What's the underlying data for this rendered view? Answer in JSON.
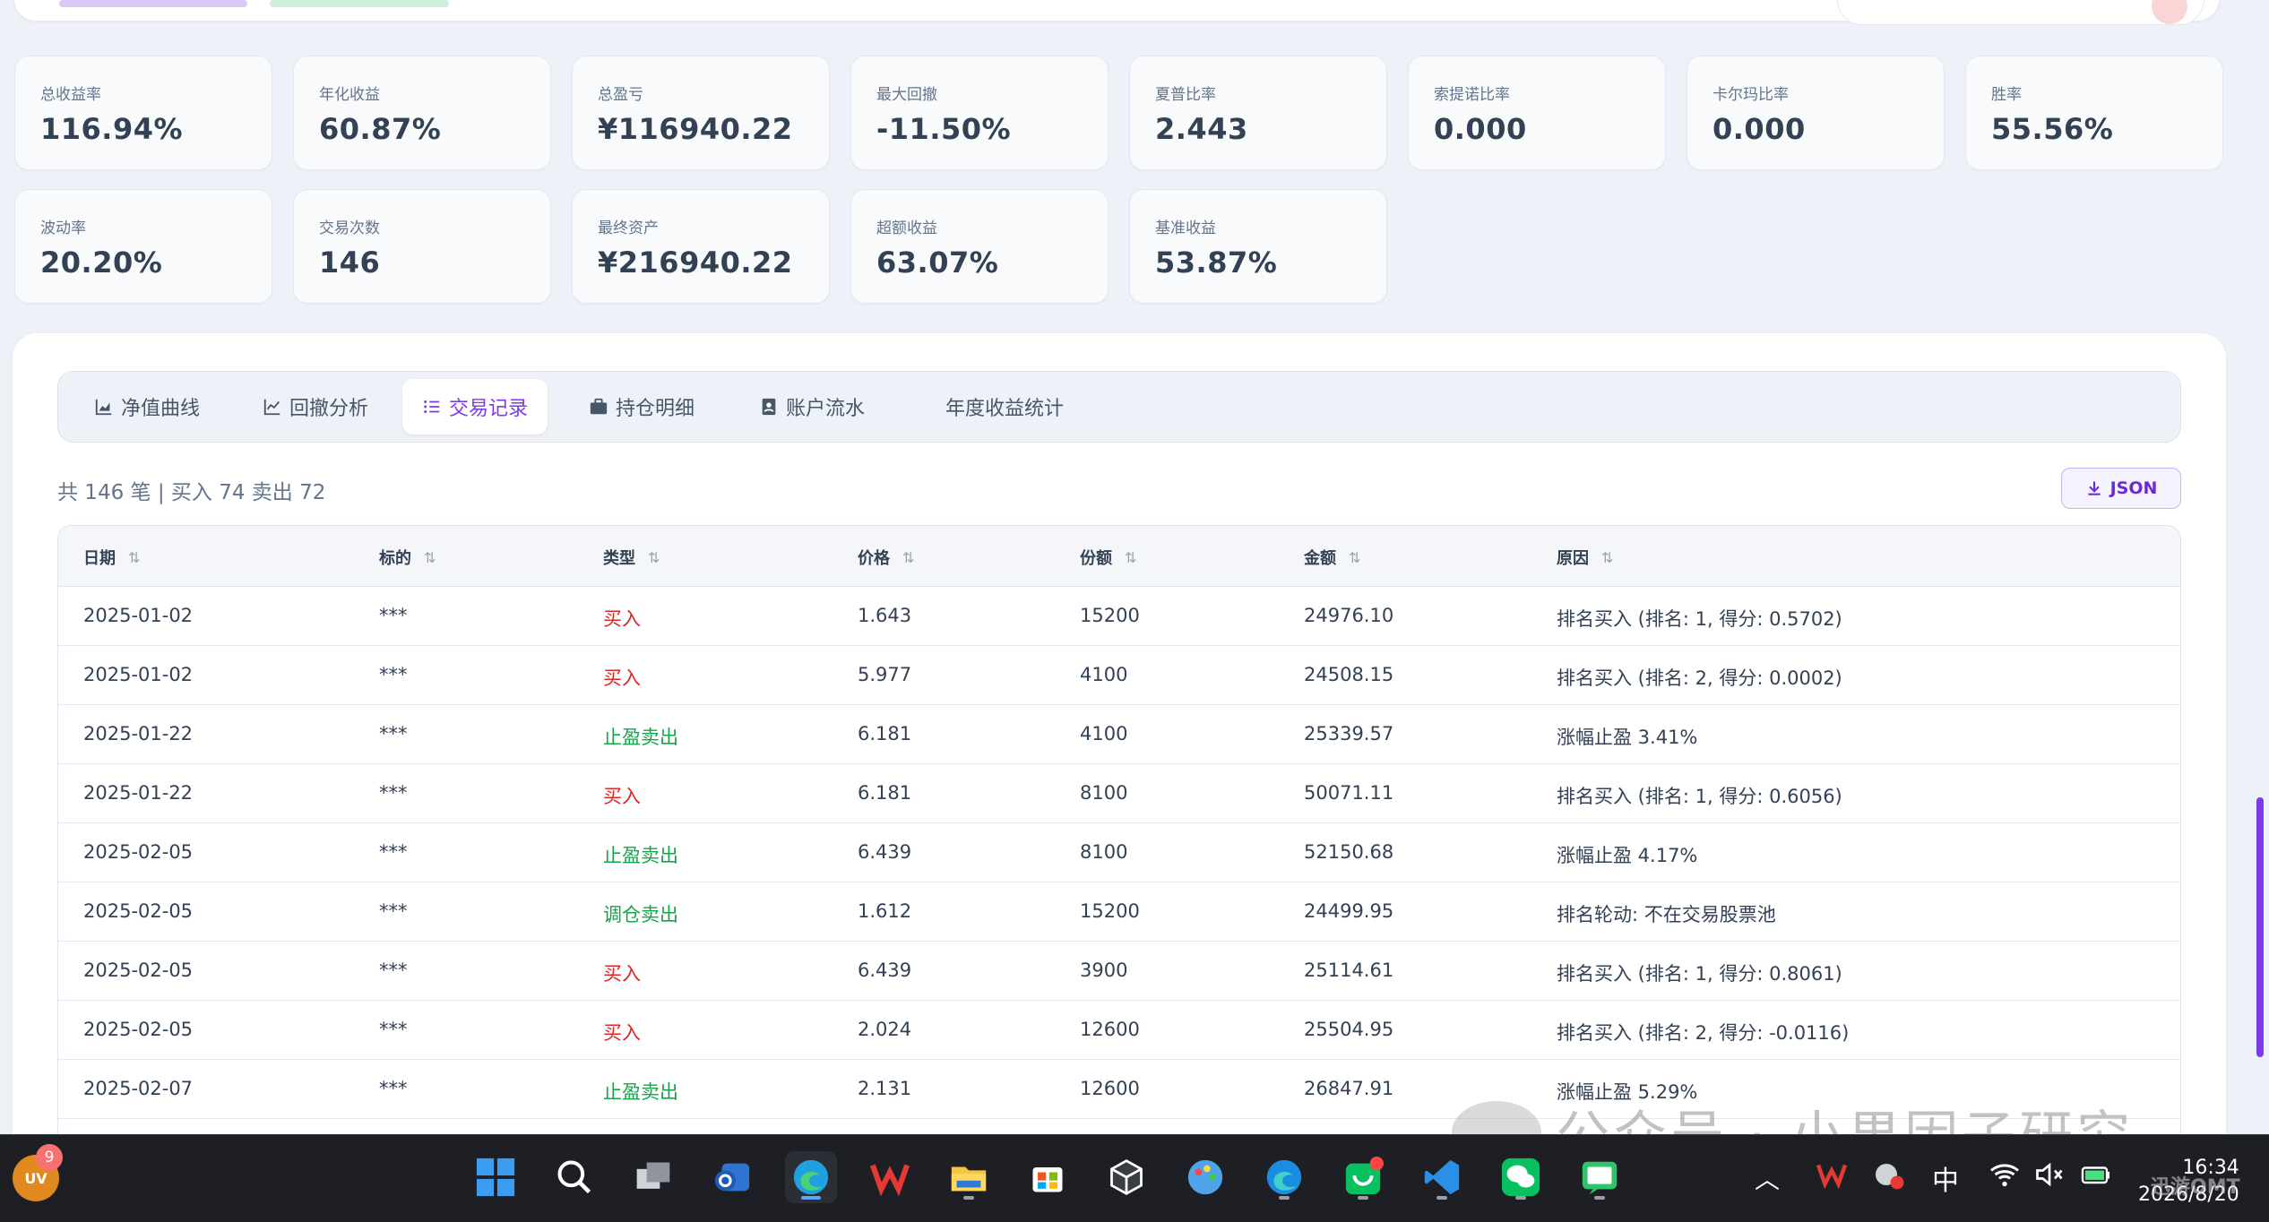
{
  "metrics": [
    {
      "label": "总收益率",
      "value": "116.94%"
    },
    {
      "label": "年化收益",
      "value": "60.87%"
    },
    {
      "label": "总盈亏",
      "value": "¥116940.22"
    },
    {
      "label": "最大回撤",
      "value": "-11.50%"
    },
    {
      "label": "夏普比率",
      "value": "2.443"
    },
    {
      "label": "索提诺比率",
      "value": "0.000"
    },
    {
      "label": "卡尔玛比率",
      "value": "0.000"
    },
    {
      "label": "胜率",
      "value": "55.56%"
    },
    {
      "label": "波动率",
      "value": "20.20%"
    },
    {
      "label": "交易次数",
      "value": "146"
    },
    {
      "label": "最终资产",
      "value": "¥216940.22"
    },
    {
      "label": "超额收益",
      "value": "63.07%"
    },
    {
      "label": "基准收益",
      "value": "53.87%"
    }
  ],
  "tabs": [
    {
      "label": "净值曲线",
      "icon": "area-chart-icon"
    },
    {
      "label": "回撤分析",
      "icon": "line-chart-icon"
    },
    {
      "label": "交易记录",
      "icon": "list-icon",
      "active": true
    },
    {
      "label": "持仓明细",
      "icon": "briefcase-icon"
    },
    {
      "label": "账户流水",
      "icon": "ledger-icon"
    },
    {
      "label": "年度收益统计",
      "icon": ""
    }
  ],
  "summary": "共 146 笔 | 买入 74 卖出 72",
  "json_button": "JSON",
  "table": {
    "headers": [
      "日期",
      "标的",
      "类型",
      "价格",
      "份额",
      "金额",
      "原因"
    ],
    "sort_icon": "⇅",
    "rows": [
      [
        "2025-01-02",
        "***",
        "买入",
        "1.643",
        "15200",
        "24976.10",
        "排名买入 (排名: 1, 得分: 0.5702)"
      ],
      [
        "2025-01-02",
        "***",
        "买入",
        "5.977",
        "4100",
        "24508.15",
        "排名买入 (排名: 2, 得分: 0.0002)"
      ],
      [
        "2025-01-22",
        "***",
        "止盈卖出",
        "6.181",
        "4100",
        "25339.57",
        "涨幅止盈 3.41%"
      ],
      [
        "2025-01-22",
        "***",
        "买入",
        "6.181",
        "8100",
        "50071.11",
        "排名买入 (排名: 1, 得分: 0.6056)"
      ],
      [
        "2025-02-05",
        "***",
        "止盈卖出",
        "6.439",
        "8100",
        "52150.68",
        "涨幅止盈 4.17%"
      ],
      [
        "2025-02-05",
        "***",
        "调仓卖出",
        "1.612",
        "15200",
        "24499.95",
        "排名轮动: 不在交易股票池"
      ],
      [
        "2025-02-05",
        "***",
        "买入",
        "6.439",
        "3900",
        "25114.61",
        "排名买入 (排名: 1, 得分: 0.8061)"
      ],
      [
        "2025-02-05",
        "***",
        "买入",
        "2.024",
        "12600",
        "25504.95",
        "排名买入 (排名: 2, 得分: -0.0116)"
      ],
      [
        "2025-02-07",
        "***",
        "止盈卖出",
        "2.131",
        "12600",
        "26847.91",
        "涨幅止盈 5.29%"
      ]
    ]
  },
  "watermark": "公众号 · 小果因子研究",
  "taskbar": {
    "uv_label": "UV",
    "uv_badge": "9",
    "ime": "中",
    "time": "16:34",
    "date": "2026/8/20",
    "brand": "迅游OMT"
  },
  "colors": {
    "accent": "#7c3aed",
    "buy": "#dc2626",
    "sell": "#16a34a"
  }
}
